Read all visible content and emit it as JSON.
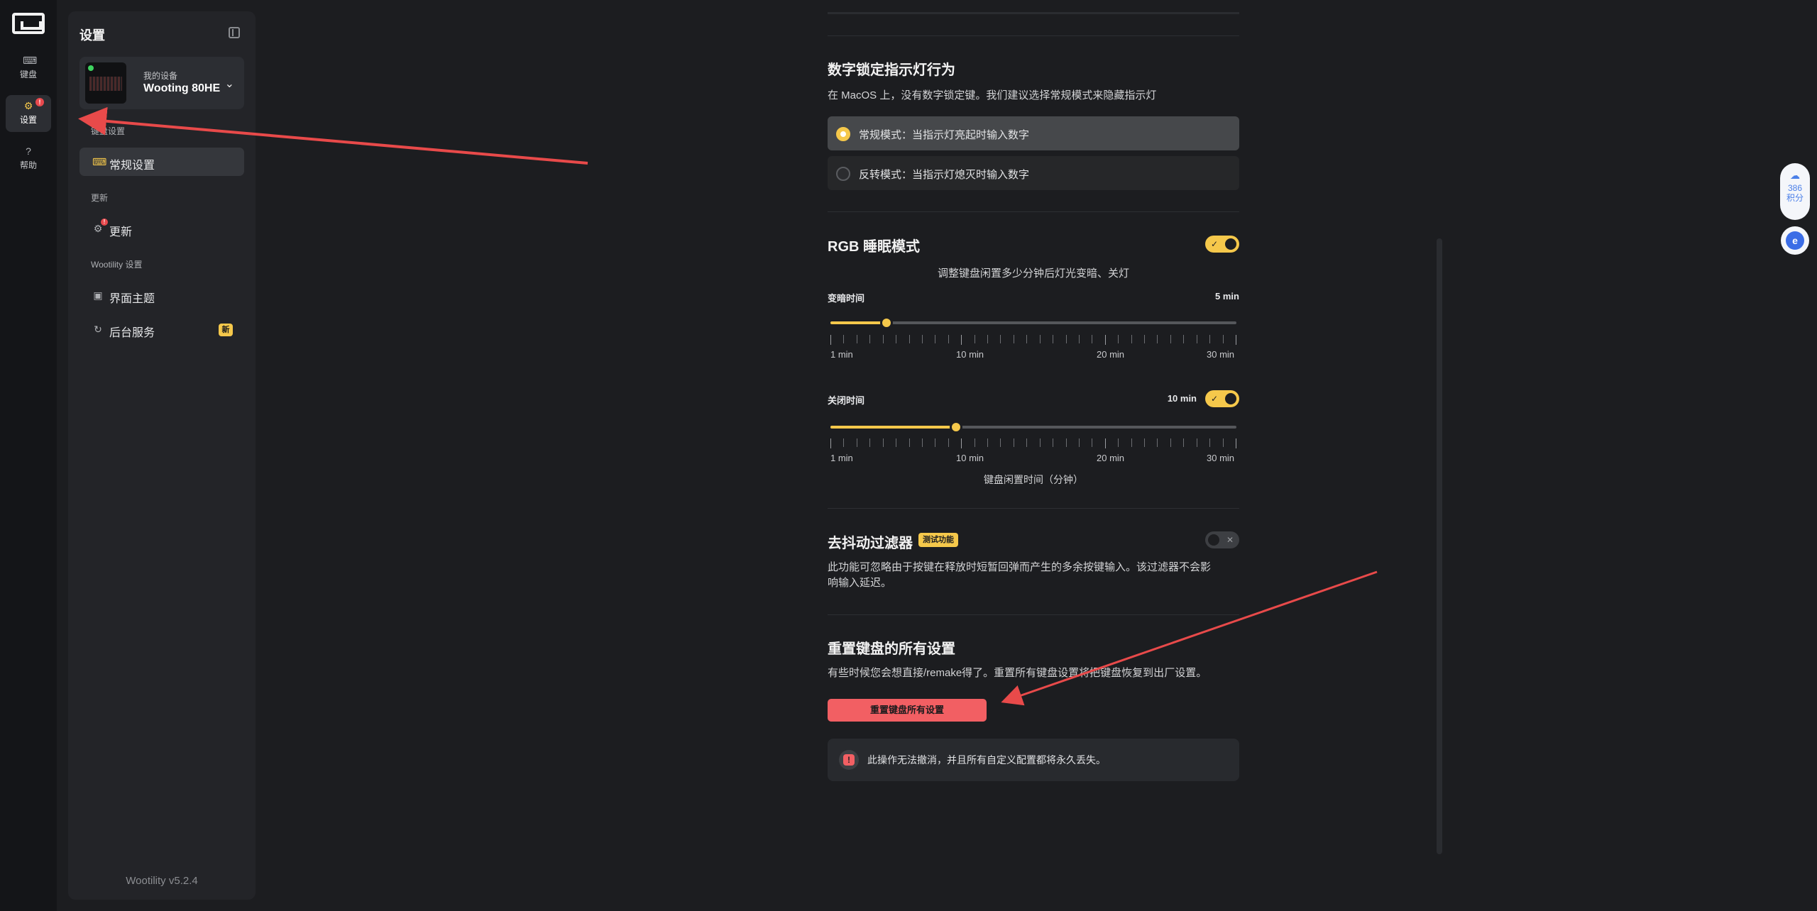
{
  "rail": {
    "items": [
      {
        "label": "键盘",
        "icon": "keyboard-icon"
      },
      {
        "label": "设置",
        "icon": "gear-icon",
        "badge": "!"
      },
      {
        "label": "帮助",
        "icon": "help-icon"
      }
    ]
  },
  "sidebar": {
    "title": "设置",
    "device": {
      "sub": "我的设备",
      "name": "Wooting 80HE"
    },
    "sections": {
      "keyboard": "键盘设置",
      "update": "更新",
      "wootility": "Wootility 设置"
    },
    "items": {
      "general": "常规设置",
      "update": "更新",
      "theme": "界面主题",
      "background": "后台服务"
    },
    "update_badge": "!",
    "new_badge": "新",
    "version": "Wootility v5.2.4"
  },
  "numlock": {
    "title": "数字锁定指示灯行为",
    "desc": "在 MacOS 上，没有数字锁定键。我们建议选择常规模式来隐藏指示灯",
    "options": [
      {
        "label": "常规模式：当指示灯亮起时输入数字",
        "selected": true
      },
      {
        "label": "反转模式：当指示灯熄灭时输入数字",
        "selected": false
      }
    ]
  },
  "rgb_sleep": {
    "title": "RGB 睡眠模式",
    "enabled": true,
    "desc": "调整键盘闲置多少分钟后灯光变暗、关灯",
    "dim": {
      "label": "变暗时间",
      "value": "5 min",
      "fraction": 0.138
    },
    "off": {
      "label": "关闭时间",
      "value": "10 min",
      "fraction": 0.31,
      "enabled": true
    },
    "tick_labels": [
      "1 min",
      "10 min",
      "20 min",
      "30 min"
    ],
    "axis_label": "键盘闲置时间（分钟）"
  },
  "debounce": {
    "title": "去抖动过滤器",
    "badge": "测试功能",
    "enabled": false,
    "desc_line1": "此功能可忽略由于按键在释放时短暂回弹而产生的多余按键输入。该过滤器不会影",
    "desc_line2": "响输入延迟。"
  },
  "reset": {
    "title": "重置键盘的所有设置",
    "desc": "有些时候您会想直接/remake得了。重置所有键盘设置将把键盘恢复到出厂设置。",
    "button": "重置键盘所有设置",
    "warning": "此操作无法撤消，并且所有自定义配置都将永久丢失。"
  },
  "float_widget": {
    "count": "386",
    "unit": "积分"
  },
  "colors": {
    "accent": "#f5c84b",
    "danger": "#f25f63",
    "annotation": "#e84a4a"
  }
}
